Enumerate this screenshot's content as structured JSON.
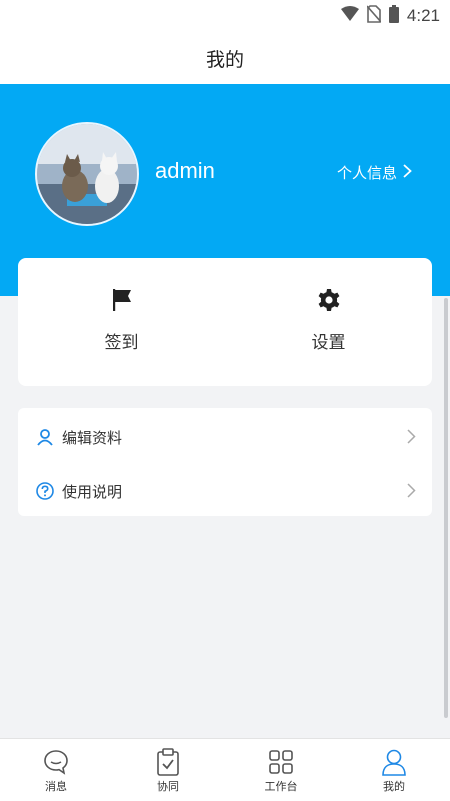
{
  "status_bar": {
    "time": "4:21",
    "icons": [
      "wifi-icon",
      "no-sim-icon",
      "battery-icon"
    ]
  },
  "header": {
    "title": "我的"
  },
  "profile": {
    "username": "admin",
    "info_link": "个人信息"
  },
  "quick_actions": [
    {
      "label": "签到",
      "icon": "flag-icon"
    },
    {
      "label": "设置",
      "icon": "gear-icon"
    }
  ],
  "menu": [
    {
      "label": "编辑资料",
      "icon": "user-icon"
    },
    {
      "label": "使用说明",
      "icon": "help-icon"
    }
  ],
  "bottom_nav": [
    {
      "label": "消息",
      "icon": "chat-bubble-icon"
    },
    {
      "label": "协同",
      "icon": "clipboard-check-icon"
    },
    {
      "label": "工作台",
      "icon": "grid-icon"
    },
    {
      "label": "我的",
      "icon": "user-icon",
      "active": true
    }
  ],
  "colors": {
    "accent": "#03a9f4",
    "active_nav": "#1e88e5",
    "background": "#f2f3f5"
  }
}
